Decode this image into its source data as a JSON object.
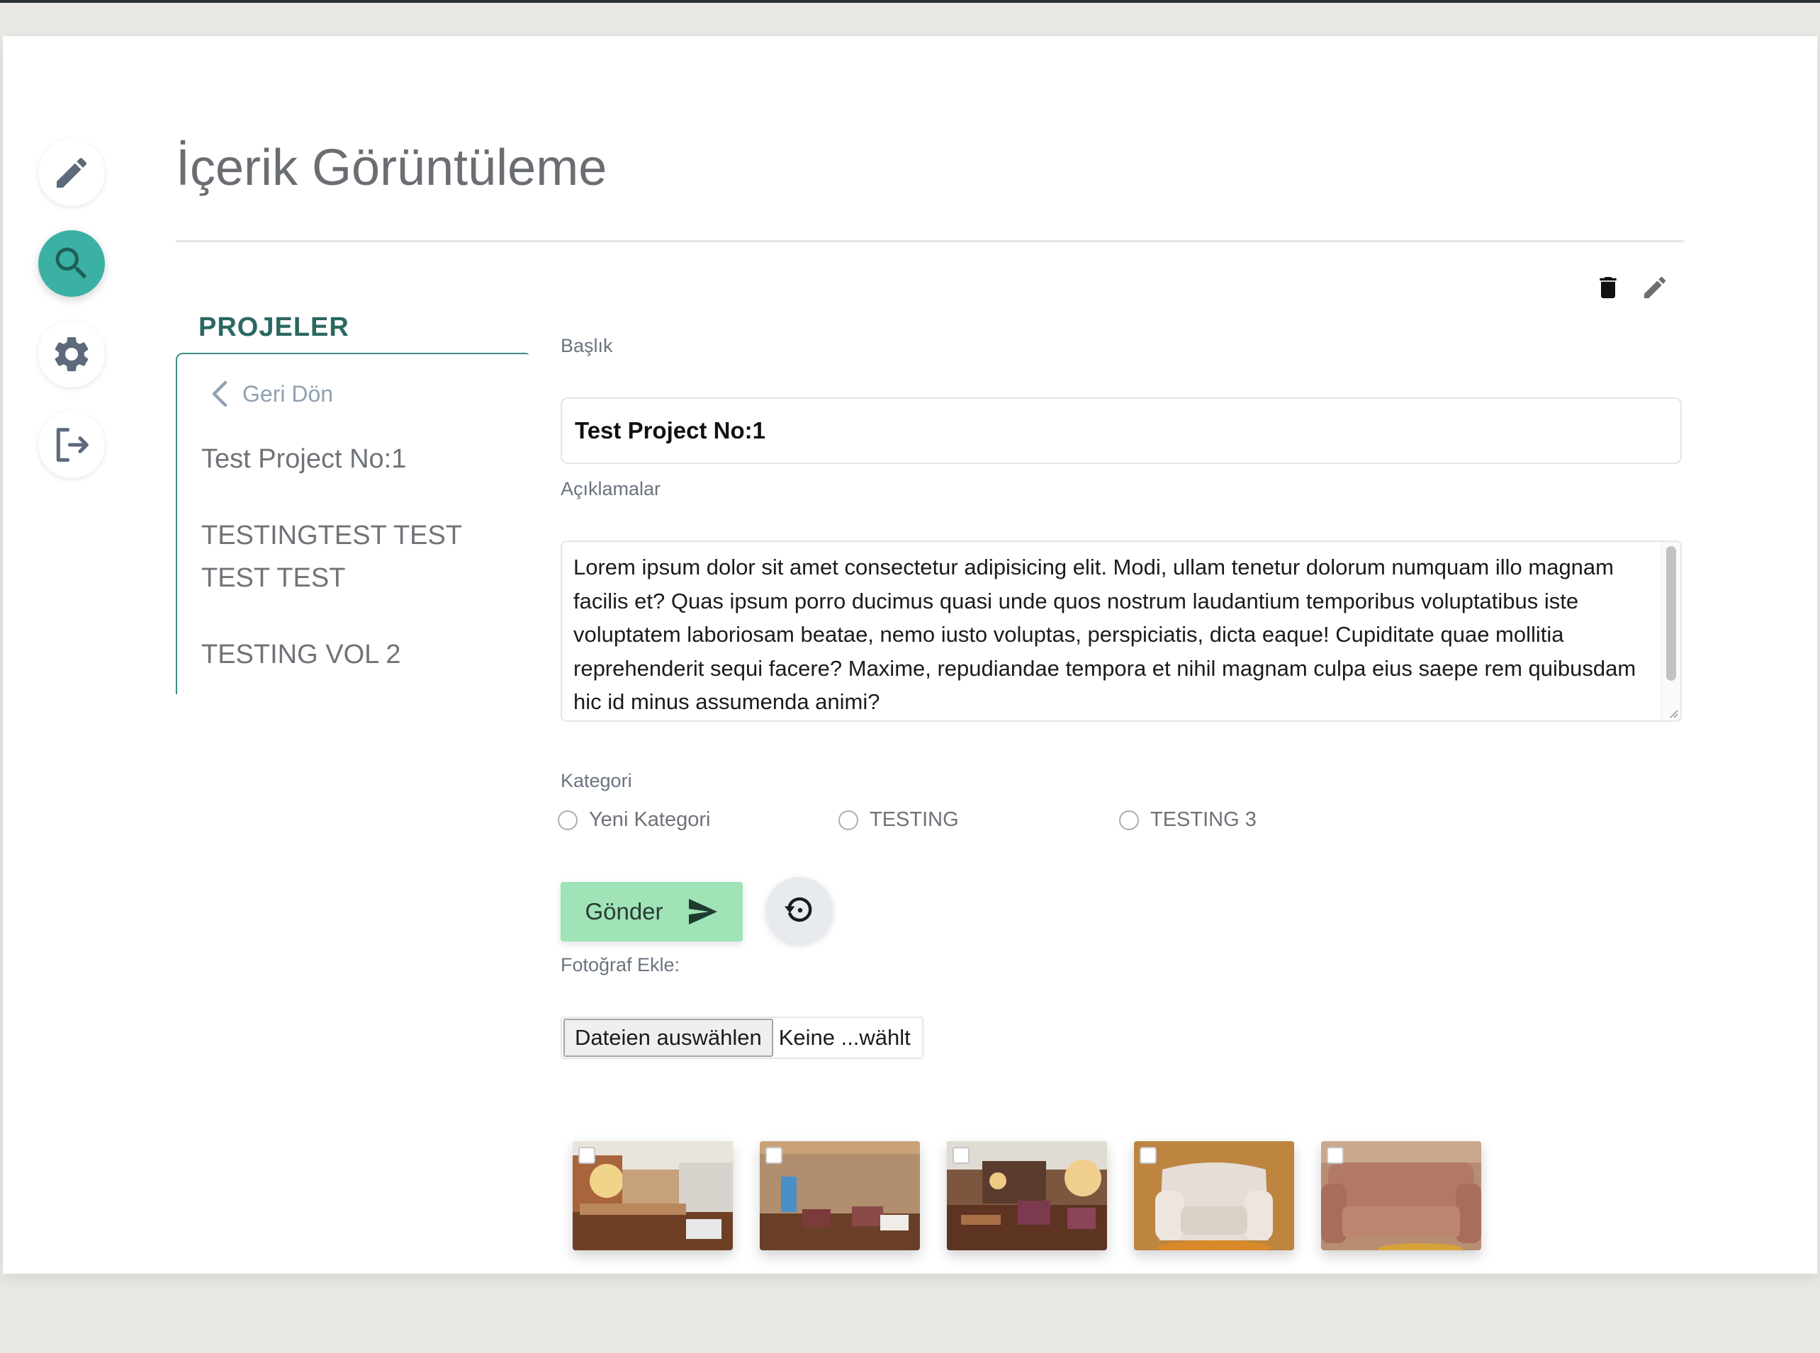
{
  "page": {
    "title": "İçerik Görüntüleme"
  },
  "sidebar": {
    "items": [
      {
        "icon": "pencil-icon",
        "active": false
      },
      {
        "icon": "search-icon",
        "active": true
      },
      {
        "icon": "gear-icon",
        "active": false
      },
      {
        "icon": "logout-icon",
        "active": false
      }
    ]
  },
  "projects": {
    "heading": "PROJELER",
    "back_label": "Geri Dön",
    "items": [
      {
        "label": "Test Project No:1"
      },
      {
        "label": "TESTINGTEST TEST TEST TEST"
      },
      {
        "label": "TESTING VOL 2"
      }
    ]
  },
  "actions": {
    "delete_icon": "trash-icon",
    "edit_icon": "pencil-icon"
  },
  "form": {
    "title_label": "Başlık",
    "title_value": "Test Project No:1",
    "description_label": "Açıklamalar",
    "description_value": "Lorem ipsum dolor sit amet consectetur adipisicing elit. Modi, ullam tenetur dolorum numquam illo magnam facilis et? Quas ipsum porro ducimus quasi unde quos nostrum laudantium temporibus voluptatibus iste voluptatem laboriosam beatae, nemo iusto voluptas, perspiciatis, dicta eaque! Cupiditate quae mollitia reprehenderit sequi facere? Maxime, repudiandae tempora et nihil magnam culpa eius saepe rem quibusdam hic id minus assumenda animi?",
    "category_label": "Kategori",
    "categories": [
      {
        "label": "Yeni Kategori",
        "selected": false
      },
      {
        "label": "TESTING",
        "selected": false
      },
      {
        "label": "TESTING 3",
        "selected": false
      }
    ],
    "submit_label": "Gönder",
    "photo_label": "Fotoğraf Ekle:",
    "file_button_label": "Dateien auswählen",
    "file_status": "Keine ...wählt"
  },
  "colors": {
    "accent": "#3bb1a5",
    "heading": "#2b6862",
    "submit": "#9fe3b6"
  },
  "photos": [
    {
      "name": "lobby-bar",
      "checked": false
    },
    {
      "name": "curtain-lounge",
      "checked": false
    },
    {
      "name": "lobby-lounge",
      "checked": false
    },
    {
      "name": "white-armchair",
      "checked": false
    },
    {
      "name": "pink-sofa",
      "checked": false
    }
  ]
}
